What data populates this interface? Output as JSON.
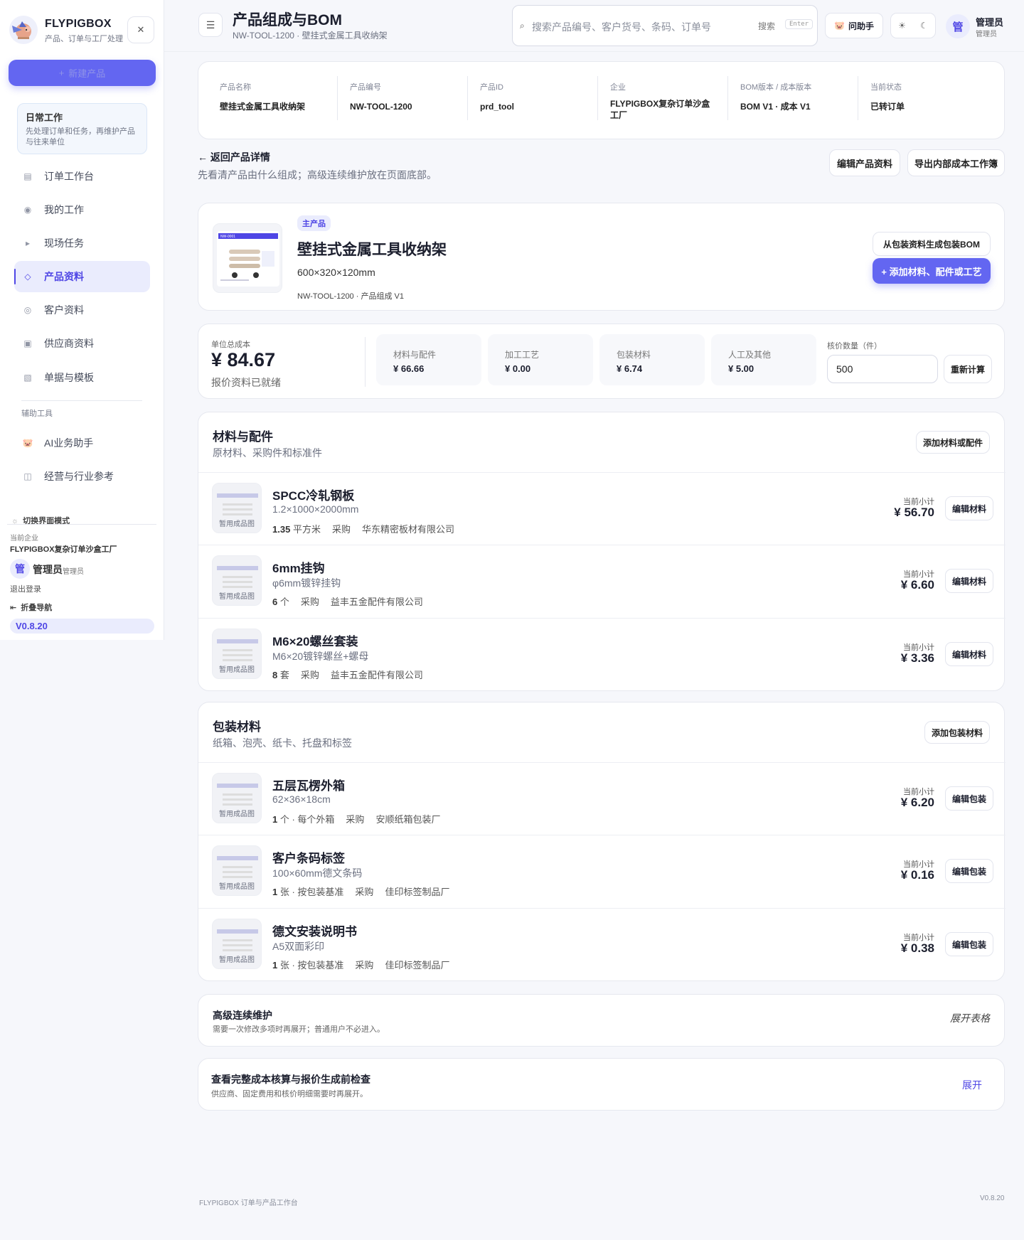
{
  "brand": {
    "name": "FLYPIGBOX",
    "subtitle": "产品、订单与工厂处理"
  },
  "sidebar": {
    "new_label": "新建产品",
    "daily_title": "日常工作",
    "daily_desc": "先处理订单和任务，再维护产品与往来单位",
    "items": [
      {
        "label": "订单工作台",
        "icon": "list-icon"
      },
      {
        "label": "我的工作",
        "icon": "radio-icon"
      },
      {
        "label": "现场任务",
        "icon": "play-icon"
      },
      {
        "label": "产品资料",
        "icon": "diamond-icon"
      },
      {
        "label": "客户资料",
        "icon": "circle-icon"
      },
      {
        "label": "供应商资料",
        "icon": "square-icon"
      },
      {
        "label": "单据与模板",
        "icon": "hatch-icon"
      }
    ],
    "aux_label": "辅助工具",
    "aux_items": [
      {
        "label": "AI业务助手",
        "icon": "pig-icon"
      },
      {
        "label": "经营与行业参考",
        "icon": "book-icon"
      }
    ],
    "mode_label": "切换界面模式",
    "org_label": "当前企业",
    "org_name": "FLYPIGBOX复杂订单沙盒工厂",
    "user_name": "管理员",
    "user_role": "管理员",
    "user_avatar": "管",
    "logout_label": "退出登录",
    "collapse_label": "折叠导航",
    "version": "V0.8.20"
  },
  "header": {
    "title": "产品组成与BOM",
    "subtitle": "NW-TOOL-1200 · 壁挂式金属工具收纳架",
    "search_placeholder": "搜索产品编号、客户货号、条码、订单号",
    "search_label": "搜索",
    "search_kbd": "Enter",
    "assistant_label": "问助手",
    "user_avatar": "管",
    "user_name": "管理员",
    "user_role": "管理员"
  },
  "info": [
    {
      "key": "产品名称",
      "value": "壁挂式金属工具收纳架"
    },
    {
      "key": "产品编号",
      "value": "NW-TOOL-1200"
    },
    {
      "key": "产品ID",
      "value": "prd_tool"
    },
    {
      "key": "企业",
      "value": "FLYPIGBOX复杂订单沙盒工厂"
    },
    {
      "key": "BOM版本 / 成本版本",
      "value": "BOM V1 · 成本 V1"
    },
    {
      "key": "当前状态",
      "value": "已转订单"
    }
  ],
  "nav": {
    "back_label": "← 返回产品详情",
    "back_desc": "先看清产品由什么组成；高级连续维护放在页面底部。",
    "edit_label": "编辑产品资料",
    "export_label": "导出内部成本工作簿"
  },
  "product": {
    "badge": "主产品",
    "name": "壁挂式金属工具收纳架",
    "size": "600×320×120mm",
    "code": "NW-TOOL-1200 · 产品组成 V1",
    "thumb_tag": "NW-0001",
    "gen_label": "从包装资料生成包装BOM",
    "add_label": "+ 添加材料、配件或工艺"
  },
  "cost": {
    "unit_label": "单位总成本",
    "unit_value": "¥ 84.67",
    "status": "报价资料已就绪",
    "stats": [
      {
        "key": "材料与配件",
        "value": "¥ 66.66"
      },
      {
        "key": "加工工艺",
        "value": "¥ 0.00"
      },
      {
        "key": "包装材料",
        "value": "¥ 6.74"
      },
      {
        "key": "人工及其他",
        "value": "¥ 5.00"
      }
    ],
    "qty_label": "核价数量（件）",
    "qty_value": "500",
    "recalc_label": "重新计算"
  },
  "materials": {
    "title": "材料与配件",
    "subtitle": "原材料、采购件和标准件",
    "add_label": "添加材料或配件",
    "thumb_label": "暂用成品图",
    "subtotal_label": "当前小计",
    "edit_label": "编辑材料",
    "items": [
      {
        "name": "SPCC冷轧钢板",
        "spec": "1.2×1000×2000mm",
        "qty": "1.35",
        "unit": "平方米",
        "type": "采购",
        "supplier": "华东精密板材有限公司",
        "subtotal": "¥ 56.70"
      },
      {
        "name": "6mm挂钩",
        "spec": "φ6mm镀锌挂钩",
        "qty": "6",
        "unit": "个",
        "type": "采购",
        "supplier": "益丰五金配件有限公司",
        "subtotal": "¥ 6.60"
      },
      {
        "name": "M6×20螺丝套装",
        "spec": "M6×20镀锌螺丝+螺母",
        "qty": "8",
        "unit": "套",
        "type": "采购",
        "supplier": "益丰五金配件有限公司",
        "subtotal": "¥ 3.36"
      }
    ]
  },
  "packaging": {
    "title": "包装材料",
    "subtitle": "纸箱、泡壳、纸卡、托盘和标签",
    "add_label": "添加包装材料",
    "thumb_label": "暂用成品图",
    "subtotal_label": "当前小计",
    "edit_label": "编辑包装",
    "items": [
      {
        "name": "五层瓦楞外箱",
        "spec": "62×36×18cm",
        "qty": "1",
        "unit": "个 · 每个外箱",
        "type": "采购",
        "supplier": "安顺纸箱包装厂",
        "subtotal": "¥ 6.20"
      },
      {
        "name": "客户条码标签",
        "spec": "100×60mm德文条码",
        "qty": "1",
        "unit": "张 · 按包装基准",
        "type": "采购",
        "supplier": "佳印标签制品厂",
        "subtotal": "¥ 0.16"
      },
      {
        "name": "德文安装说明书",
        "spec": "A5双面彩印",
        "qty": "1",
        "unit": "张 · 按包装基准",
        "type": "采购",
        "supplier": "佳印标签制品厂",
        "subtotal": "¥ 0.38"
      }
    ]
  },
  "advanced": {
    "title": "高级连续维护",
    "desc": "需要一次修改多项时再展开；普通用户不必进入。",
    "action": "展开表格"
  },
  "full_cost": {
    "title": "查看完整成本核算与报价生成前检查",
    "desc": "供应商、固定费用和核价明细需要时再展开。",
    "action": "展开"
  },
  "footer": {
    "left": "FLYPIGBOX 订单与产品工作台",
    "right": "V0.8.20"
  }
}
